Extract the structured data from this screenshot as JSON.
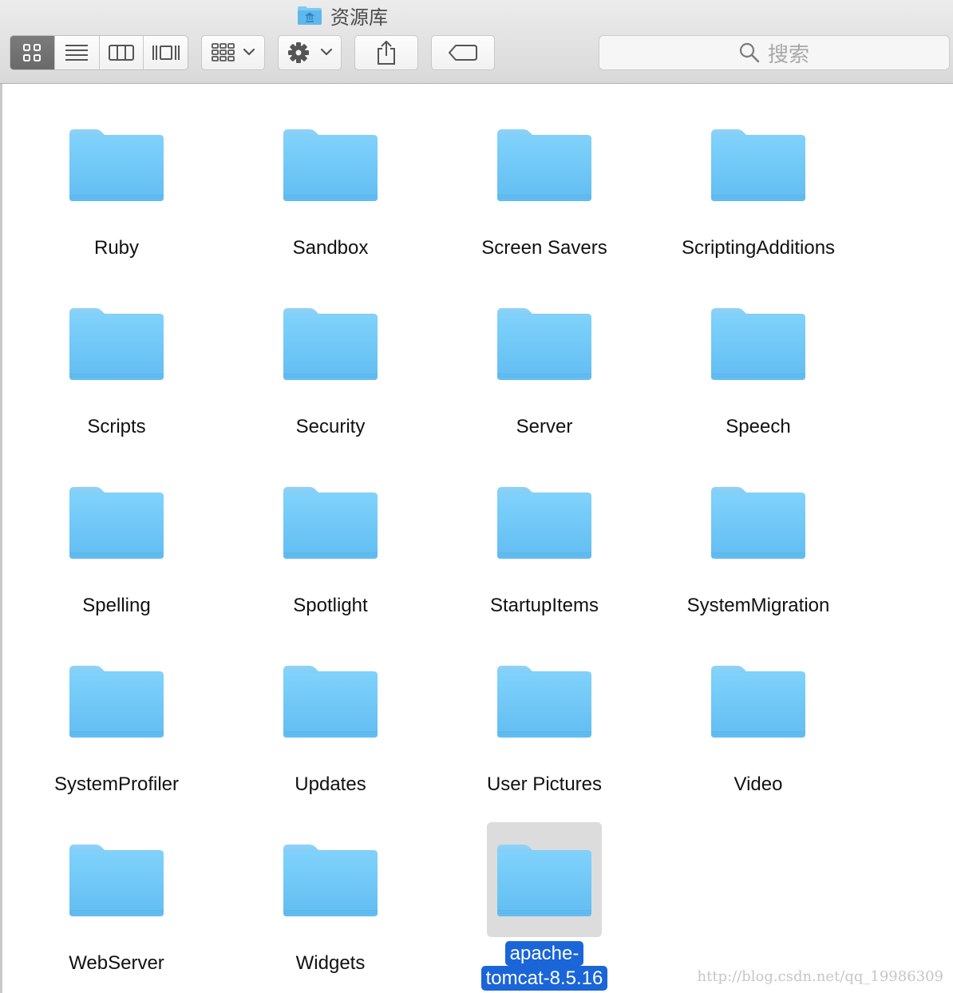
{
  "window": {
    "title": "资源库"
  },
  "toolbar": {
    "view_modes": [
      {
        "icon": "icon-view-grid-icon",
        "active": true
      },
      {
        "icon": "list-view-icon",
        "active": false
      },
      {
        "icon": "column-view-icon",
        "active": false
      },
      {
        "icon": "cover-flow-icon",
        "active": false
      }
    ],
    "arrange_icon": "arrange-grid-icon",
    "action_icon": "gear-icon",
    "share_icon": "share-icon",
    "tag_icon": "tag-icon",
    "search_placeholder": "搜索"
  },
  "colors": {
    "folder_blue": "#6fc8f6",
    "selection_blue": "#1a65d8",
    "active_segment": "#6e6e6e"
  },
  "items": [
    {
      "name": "Ruby"
    },
    {
      "name": "Sandbox"
    },
    {
      "name": "Screen Savers"
    },
    {
      "name": "ScriptingAdditions"
    },
    {
      "name": "Scripts"
    },
    {
      "name": "Security"
    },
    {
      "name": "Server"
    },
    {
      "name": "Speech"
    },
    {
      "name": "Spelling"
    },
    {
      "name": "Spotlight"
    },
    {
      "name": "StartupItems"
    },
    {
      "name": "SystemMigration"
    },
    {
      "name": "SystemProfiler"
    },
    {
      "name": "Updates"
    },
    {
      "name": "User Pictures"
    },
    {
      "name": "Video"
    },
    {
      "name": "WebServer"
    },
    {
      "name": "Widgets"
    },
    {
      "name": "apache-tomcat-8.5.16",
      "selected": true,
      "label_lines": [
        "apache-",
        "tomcat-8.5.16"
      ]
    }
  ],
  "watermark": "http://blog.csdn.net/qq_19986309"
}
